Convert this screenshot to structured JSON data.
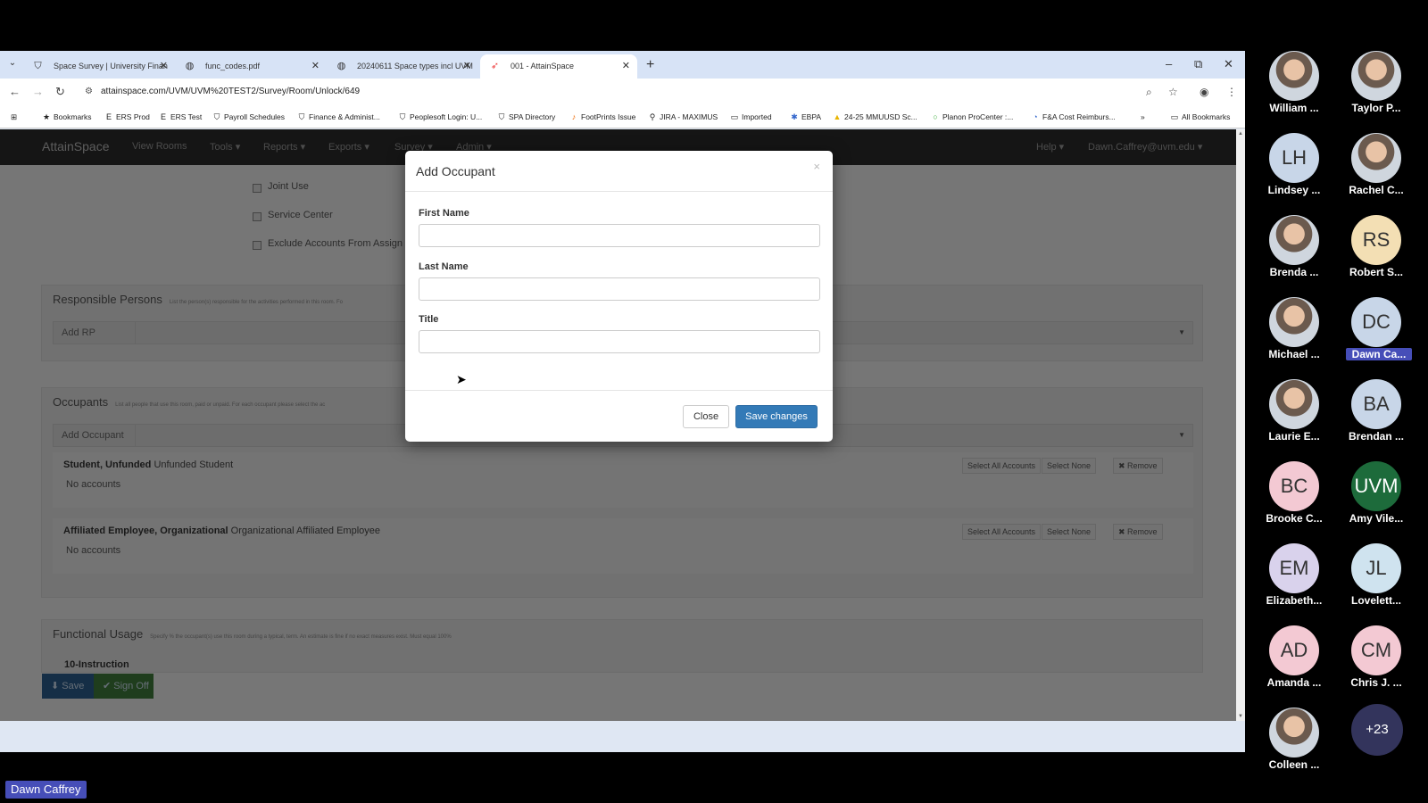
{
  "browser": {
    "tabs": [
      {
        "title": "Space Survey | University Finan",
        "icon": "shield-icon"
      },
      {
        "title": "func_codes.pdf",
        "icon": "globe-icon"
      },
      {
        "title": "20240611 Space types incl UVM",
        "icon": "globe-icon"
      },
      {
        "title": "001 - AttainSpace",
        "icon": "attainspace-icon"
      }
    ],
    "url": "attainspace.com/UVM/UVM%20TEST2/Survey/Room/Unlock/649",
    "bookmarks": [
      "Bookmarks",
      "ERS Prod",
      "ERS Test",
      "Payroll Schedules",
      "Finance & Administ...",
      "Peoplesoft Login: U...",
      "SPA Directory",
      "FootPrints Issue",
      "JIRA - MAXIMUS",
      "Imported",
      "EBPA",
      "24-25 MMUUSD Sc...",
      "Planon ProCenter :...",
      "F&A Cost Reimburs..."
    ],
    "all_bookmarks": "All Bookmarks"
  },
  "app": {
    "brand": "AttainSpace",
    "nav": [
      "View Rooms",
      "Tools ▾",
      "Reports ▾",
      "Exports ▾",
      "Survey ▾",
      "Admin ▾"
    ],
    "help": "Help ▾",
    "user": "Dawn.Caffrey@uvm.edu ▾",
    "checkboxes": [
      "Joint Use",
      "Service Center",
      "Exclude Accounts From Assign"
    ],
    "responsible": {
      "title": "Responsible Persons",
      "note": "List the person(s) responsible for the activities performed in this room. Fo",
      "add": "Add RP"
    },
    "occupants": {
      "title": "Occupants",
      "note": "List all people that use this room, paid or unpaid. For each occupant please select the ac",
      "add": "Add Occupant",
      "rows": [
        {
          "name": "Student, Unfunded",
          "desc": "Unfunded Student",
          "accounts": "No accounts"
        },
        {
          "name": "Affiliated Employee, Organizational",
          "desc": "Organizational Affiliated Employee",
          "accounts": "No accounts"
        }
      ],
      "select_all": "Select All Accounts",
      "select_none": "Select None",
      "remove": "✖ Remove"
    },
    "functional": {
      "title": "Functional Usage",
      "note": "Specify % the occupant(s) use this room during a typical, term. An estimate is fine if no exact measures exist. Must equal 100%",
      "row": "10-Instruction"
    },
    "save": "Save",
    "signoff": "Sign Off"
  },
  "modal": {
    "title": "Add Occupant",
    "close_x": "×",
    "first_name_label": "First Name",
    "first_name_value": "",
    "last_name_label": "Last Name",
    "last_name_value": "",
    "title_label": "Title",
    "title_value": "",
    "close_btn": "Close",
    "save_btn": "Save changes"
  },
  "participants": [
    {
      "name": "William ...",
      "initials": ""
    },
    {
      "name": "Taylor P...",
      "initials": ""
    },
    {
      "name": "Lindsey ...",
      "initials": "LH"
    },
    {
      "name": "Rachel C...",
      "initials": ""
    },
    {
      "name": "Brenda ...",
      "initials": ""
    },
    {
      "name": "Robert S...",
      "initials": "RS"
    },
    {
      "name": "Michael ...",
      "initials": ""
    },
    {
      "name": "Dawn Ca...",
      "initials": "DC"
    },
    {
      "name": "Laurie E...",
      "initials": ""
    },
    {
      "name": "Brendan ...",
      "initials": "BA"
    },
    {
      "name": "Brooke C...",
      "initials": "BC"
    },
    {
      "name": "Amy Vile...",
      "initials": "UVM"
    },
    {
      "name": "Elizabeth...",
      "initials": "EM"
    },
    {
      "name": "Lovelett...",
      "initials": "JL"
    },
    {
      "name": "Amanda ...",
      "initials": "AD"
    },
    {
      "name": "Chris J. ...",
      "initials": "CM"
    },
    {
      "name": "Colleen ...",
      "initials": ""
    }
  ],
  "more_participants": "+23",
  "speaker": "Dawn Caffrey"
}
